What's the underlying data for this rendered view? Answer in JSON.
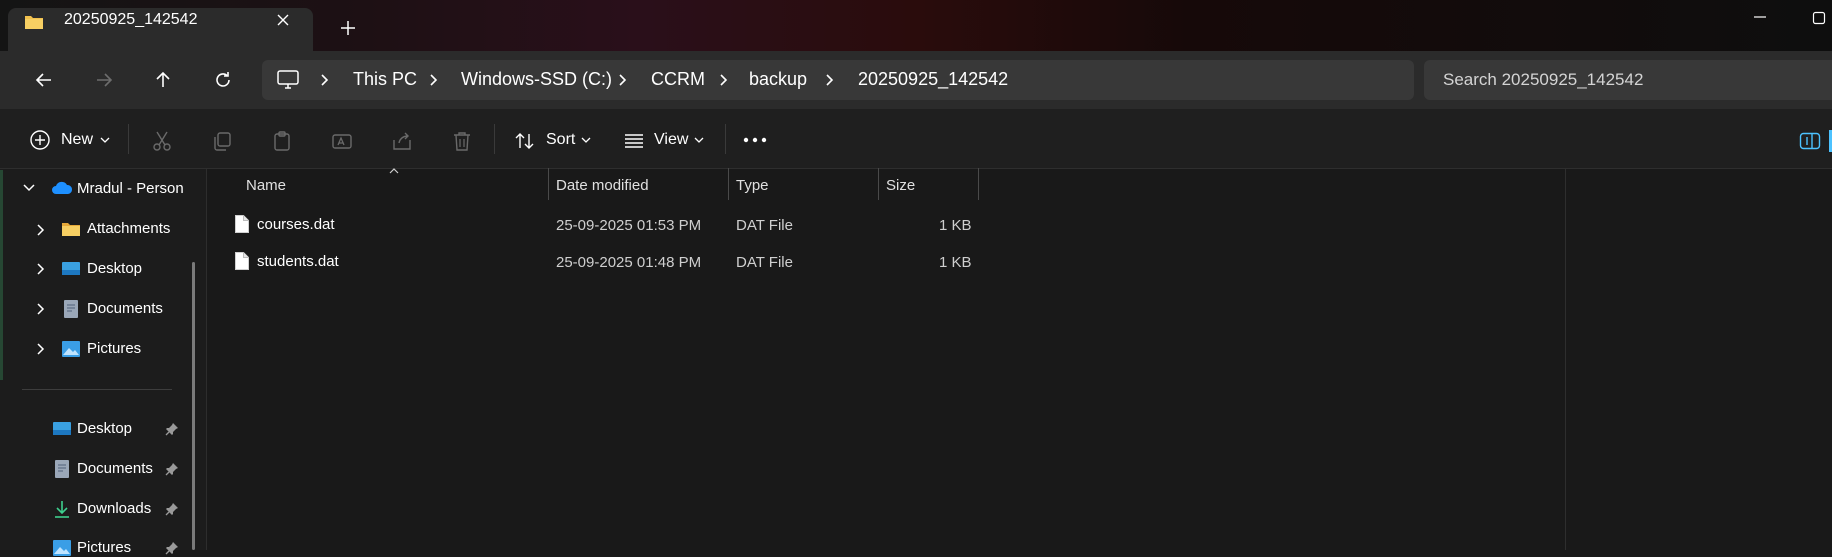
{
  "tab": {
    "title": "20250925_142542"
  },
  "breadcrumb": {
    "items": [
      "This PC",
      "Windows-SSD (C:)",
      "CCRM",
      "backup",
      "20250925_142542"
    ]
  },
  "search": {
    "placeholder": "Search 20250925_142542"
  },
  "toolbar": {
    "new_label": "New",
    "sort_label": "Sort",
    "view_label": "View"
  },
  "sidebar": {
    "onedrive_label": "Mradul - Persona",
    "tree": [
      {
        "label": "Attachments",
        "icon": "folder-icon"
      },
      {
        "label": "Desktop",
        "icon": "desktop-icon"
      },
      {
        "label": "Documents",
        "icon": "documents-icon"
      },
      {
        "label": "Pictures",
        "icon": "pictures-icon"
      }
    ],
    "quick_access": [
      {
        "label": "Desktop",
        "icon": "desktop-icon",
        "pinned": true
      },
      {
        "label": "Documents",
        "icon": "documents-icon",
        "pinned": true
      },
      {
        "label": "Downloads",
        "icon": "download-icon",
        "pinned": true
      },
      {
        "label": "Pictures",
        "icon": "pictures-icon",
        "pinned": true
      }
    ]
  },
  "columns": {
    "name": "Name",
    "date": "Date modified",
    "type": "Type",
    "size": "Size"
  },
  "files": [
    {
      "name": "courses.dat",
      "date": "25-09-2025 01:53 PM",
      "type": "DAT File",
      "size": "1 KB"
    },
    {
      "name": "students.dat",
      "date": "25-09-2025 01:48 PM",
      "type": "DAT File",
      "size": "1 KB"
    }
  ],
  "colors": {
    "accent": "#4cc2ff",
    "folder": "#f2c14e",
    "background": "#191919"
  }
}
